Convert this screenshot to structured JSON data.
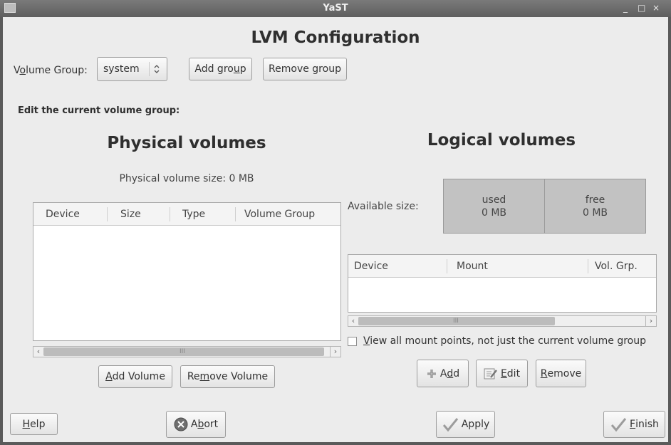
{
  "window": {
    "title": "YaST",
    "controls": [
      "_",
      "□",
      "×"
    ]
  },
  "header": {
    "title": "LVM Configuration"
  },
  "volume_group": {
    "label_pre": "V",
    "label_key": "o",
    "label_post": "lume Group:",
    "selected": "system",
    "add_pre": "Add gro",
    "add_key": "u",
    "add_post": "p",
    "remove_label": "Remove group"
  },
  "edit_label": "Edit the current volume group:",
  "physical": {
    "title": "Physical volumes",
    "size_text": "Physical volume size:  0 MB",
    "columns": [
      "Device",
      "Size",
      "Type",
      "Volume Group"
    ],
    "add_pre": "",
    "add_key": "A",
    "add_post": "dd Volume",
    "remove_pre": "Re",
    "remove_key": "m",
    "remove_post": "ove Volume"
  },
  "logical": {
    "title": "Logical volumes",
    "available_label": "Available size:",
    "used_label": "used",
    "used_value": "0 MB",
    "free_label": "free",
    "free_value": "0 MB",
    "used_fraction": 0.0,
    "columns": [
      "Device",
      "Mount",
      "Vol. Grp."
    ],
    "checkbox_pre": "",
    "checkbox_key": "V",
    "checkbox_post": "iew all mount points, not just the current volume group",
    "checkbox_checked": false,
    "add_pre": "A",
    "add_key": "d",
    "add_post": "d",
    "edit_pre": "",
    "edit_key": "E",
    "edit_post": "dit",
    "remove_pre": "",
    "remove_key": "R",
    "remove_post": "emove"
  },
  "footer": {
    "help_pre": "",
    "help_key": "H",
    "help_post": "elp",
    "abort_pre": "A",
    "abort_key": "b",
    "abort_post": "ort",
    "apply_label": "Apply",
    "finish_pre": "",
    "finish_key": "F",
    "finish_post": "inish"
  },
  "scroll_grip": "III"
}
